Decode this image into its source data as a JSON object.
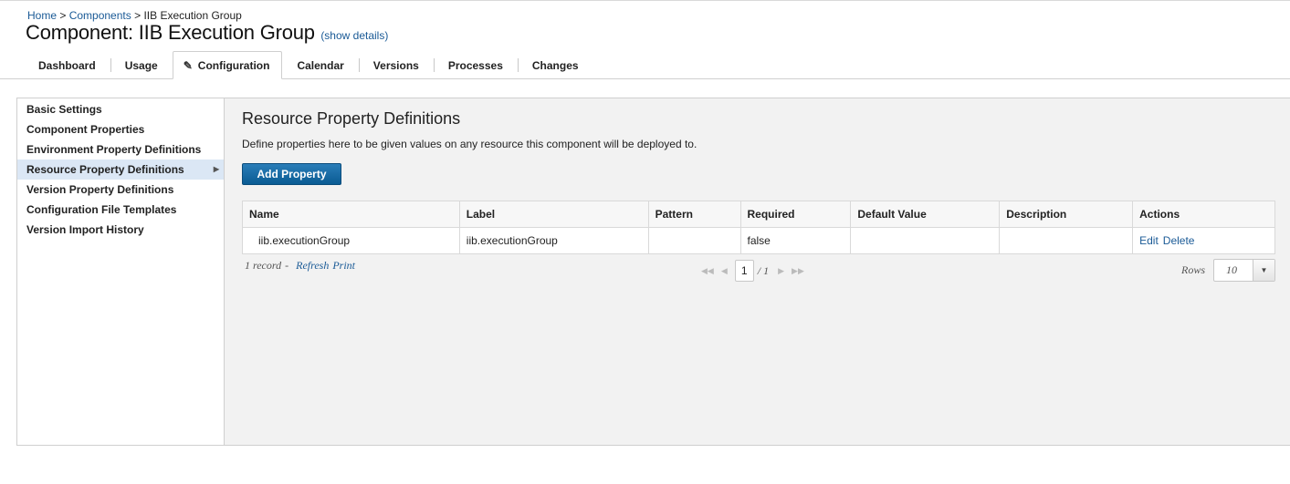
{
  "breadcrumb": {
    "home": "Home",
    "sep1": " > ",
    "components": "Components",
    "sep2": " > ",
    "current": "IIB Execution Group"
  },
  "header": {
    "title": "Component: IIB Execution Group",
    "show_details": "(show details)"
  },
  "tabs": [
    {
      "label": "Dashboard"
    },
    {
      "label": "Usage"
    },
    {
      "label": "Configuration",
      "icon": "pencil-icon",
      "active": true
    },
    {
      "label": "Calendar"
    },
    {
      "label": "Versions"
    },
    {
      "label": "Processes"
    },
    {
      "label": "Changes"
    }
  ],
  "sidebar": {
    "items": [
      {
        "label": "Basic Settings"
      },
      {
        "label": "Component Properties"
      },
      {
        "label": "Environment Property Definitions"
      },
      {
        "label": "Resource Property Definitions",
        "active": true
      },
      {
        "label": "Version Property Definitions"
      },
      {
        "label": "Configuration File Templates"
      },
      {
        "label": "Version Import History"
      }
    ]
  },
  "main": {
    "title": "Resource Property Definitions",
    "description": "Define properties here to be given values on any resource this component will be deployed to.",
    "add_button": "Add Property",
    "table": {
      "headers": [
        "Name",
        "Label",
        "Pattern",
        "Required",
        "Default Value",
        "Description",
        "Actions"
      ],
      "rows": [
        {
          "name": "iib.executionGroup",
          "label": "iib.executionGroup",
          "pattern": "",
          "required": "false",
          "default_value": "",
          "description": "",
          "actions": [
            "Edit",
            "Delete"
          ]
        }
      ]
    },
    "footer": {
      "record_count": "1 record",
      "dash": "-",
      "refresh": "Refresh",
      "print": "Print",
      "page": "1",
      "page_total": "/ 1",
      "rows_label": "Rows",
      "rows_value": "10"
    }
  },
  "colors": {
    "link": "#1a5a96",
    "button": "#0a5b93",
    "active_sidebar": "#dbe7f5",
    "panel_bg": "#f2f2f2"
  }
}
